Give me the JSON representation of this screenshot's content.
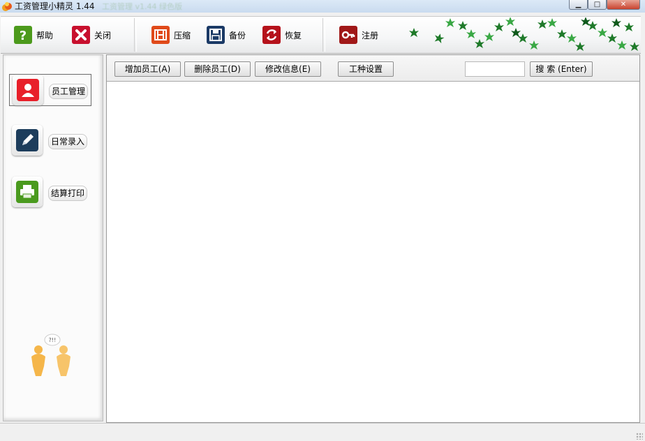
{
  "window": {
    "title": "工资管理小精灵 1.44",
    "subtitle_ghost": "工资管理 v1.44 绿色版",
    "controls": {
      "minimize": "▁",
      "maximize": "□",
      "close": "✕"
    }
  },
  "toolbar": {
    "items": [
      {
        "label": "帮助",
        "icon": "help-icon",
        "color": "#4c9a1c"
      },
      {
        "label": "关闭",
        "icon": "close-icon",
        "color": "#c8102e"
      },
      {
        "label": "压缩",
        "icon": "compress-icon",
        "color": "#e04a1a"
      },
      {
        "label": "备份",
        "icon": "save-icon",
        "color": "#1b3a66"
      },
      {
        "label": "恢复",
        "icon": "restore-icon",
        "color": "#b5121b"
      },
      {
        "label": "注册",
        "icon": "key-icon",
        "color": "#a01818"
      }
    ]
  },
  "sidebar": {
    "items": [
      {
        "label": "员工管理",
        "icon": "employee-icon",
        "color": "#e8202a",
        "active": true
      },
      {
        "label": "日常录入",
        "icon": "pencil-icon",
        "color": "#1d3d5c",
        "active": false
      },
      {
        "label": "结算打印",
        "icon": "printer-icon",
        "color": "#4a9a1e",
        "active": false
      }
    ],
    "mascot_text": "?!!"
  },
  "actions": {
    "add": "增加员工(A)",
    "delete": "删除员工(D)",
    "modify": "修改信息(E)",
    "job_settings": "工种设置",
    "search": "搜 索 (Enter)",
    "search_value": ""
  },
  "statusbar": {
    "text": ""
  }
}
